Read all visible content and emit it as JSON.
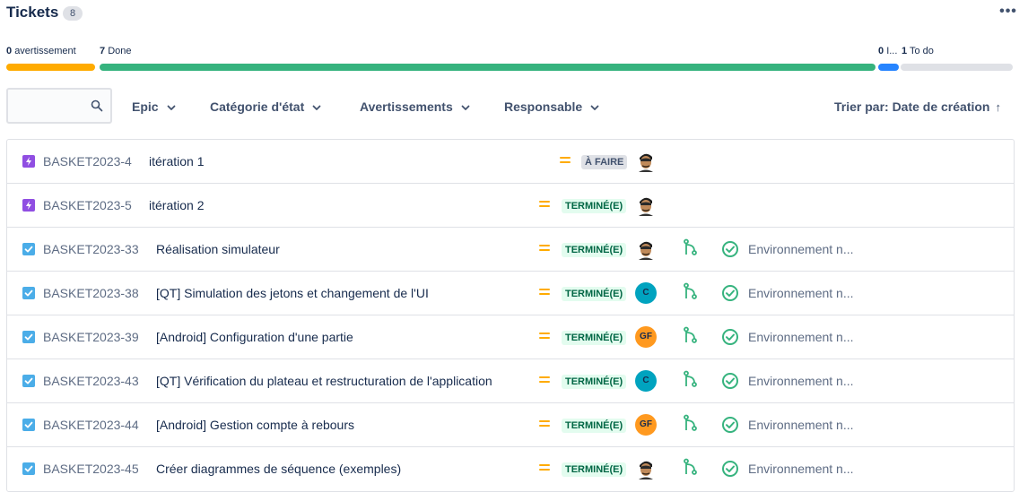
{
  "header": {
    "title": "Tickets",
    "count": "8",
    "more_label": "•••"
  },
  "progress": {
    "warnings_count": "0",
    "warnings_label": "avertissement",
    "done_count": "7",
    "done_label": "Done",
    "inprogress_count": "0",
    "inprogress_label": "I...",
    "todo_count": "1",
    "todo_label": "To do",
    "warnings_fraction": 0.0,
    "done_fraction": 0.875,
    "inprogress_fraction": 0.0,
    "todo_fraction": 0.125,
    "colors": {
      "warnings": "#ffab00",
      "done": "#36b37e",
      "inprogress": "#2684ff",
      "todo": "#dfe1e6"
    }
  },
  "toolbar": {
    "search_value": "",
    "filters": [
      "Epic",
      "Catégorie d'état",
      "Avertissements",
      "Responsable"
    ],
    "sort_label": "Trier par: Date de création",
    "sort_arrow": "↑"
  },
  "rows": [
    {
      "type": "epic",
      "key": "BASKET2023-4",
      "summary": "itération 1",
      "priority": "medium",
      "status": "À FAIRE",
      "status_kind": "todo",
      "assignee": "photo",
      "assignee_initials": "",
      "dev": false,
      "env": ""
    },
    {
      "type": "epic",
      "key": "BASKET2023-5",
      "summary": "itération 2",
      "priority": "medium",
      "status": "TERMINÉ(E)",
      "status_kind": "done",
      "assignee": "photo",
      "assignee_initials": "",
      "dev": false,
      "env": ""
    },
    {
      "type": "task",
      "key": "BASKET2023-33",
      "summary": "Réalisation simulateur",
      "priority": "medium",
      "status": "TERMINÉ(E)",
      "status_kind": "done",
      "assignee": "photo",
      "assignee_initials": "",
      "dev": true,
      "env": "Environnement n..."
    },
    {
      "type": "task",
      "key": "BASKET2023-38",
      "summary": "[QT] Simulation des jetons et changement de l'UI",
      "priority": "medium",
      "status": "TERMINÉ(E)",
      "status_kind": "done",
      "assignee": "c",
      "assignee_initials": "C",
      "dev": true,
      "env": "Environnement n..."
    },
    {
      "type": "task",
      "key": "BASKET2023-39",
      "summary": "[Android] Configuration d'une partie",
      "priority": "medium",
      "status": "TERMINÉ(E)",
      "status_kind": "done",
      "assignee": "gf",
      "assignee_initials": "GF",
      "dev": true,
      "env": "Environnement n..."
    },
    {
      "type": "task",
      "key": "BASKET2023-43",
      "summary": "[QT] Vérification du plateau et restructuration de l'application",
      "priority": "medium",
      "status": "TERMINÉ(E)",
      "status_kind": "done",
      "assignee": "c",
      "assignee_initials": "C",
      "dev": true,
      "env": "Environnement n..."
    },
    {
      "type": "task",
      "key": "BASKET2023-44",
      "summary": "[Android] Gestion compte à rebours",
      "priority": "medium",
      "status": "TERMINÉ(E)",
      "status_kind": "done",
      "assignee": "gf",
      "assignee_initials": "GF",
      "dev": true,
      "env": "Environnement n..."
    },
    {
      "type": "task",
      "key": "BASKET2023-45",
      "summary": "Créer diagrammes de séquence (exemples)",
      "priority": "medium",
      "status": "TERMINÉ(E)",
      "status_kind": "done",
      "assignee": "photo",
      "assignee_initials": "",
      "dev": true,
      "env": "Environnement n..."
    }
  ]
}
